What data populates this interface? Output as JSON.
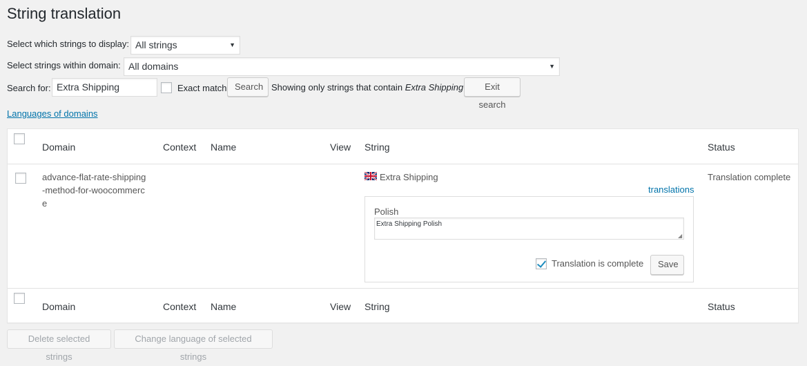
{
  "page": {
    "title": "String translation"
  },
  "filters": {
    "display_label": "Select which strings to display:",
    "display_value": "All strings",
    "domain_label": "Select strings within domain:",
    "domain_value": "All domains",
    "search_label": "Search for:",
    "search_value": "Extra Shipping",
    "exact_match_label": "Exact match",
    "exact_match_checked": false,
    "search_button": "Search",
    "showing_prefix": "Showing only strings that contain",
    "showing_term": "Extra Shipping",
    "exit_search_button": "Exit search"
  },
  "languages_link": "Languages of domains",
  "table": {
    "headers": {
      "domain": "Domain",
      "context": "Context",
      "name": "Name",
      "view": "View",
      "string": "String",
      "status": "Status"
    },
    "rows": [
      {
        "domain_lines": [
          "advance-flat-rate-shipping",
          "-method-for-woocommerc",
          "e"
        ],
        "context": "",
        "name": "",
        "view": "",
        "flag": "uk-flag-icon",
        "string": "Extra Shipping",
        "translations_link": "translations",
        "status": "Translation complete",
        "translation": {
          "language": "Polish",
          "value": "Extra Shipping Polish",
          "complete_label": "Translation is complete",
          "complete_checked": true,
          "save_button": "Save"
        }
      }
    ]
  },
  "bulk_actions": {
    "delete_button": "Delete selected strings",
    "change_language_button": "Change language of selected strings"
  },
  "colors": {
    "link": "#0073aa",
    "background": "#f1f1f1",
    "checkmark": "#1e8cbe"
  }
}
